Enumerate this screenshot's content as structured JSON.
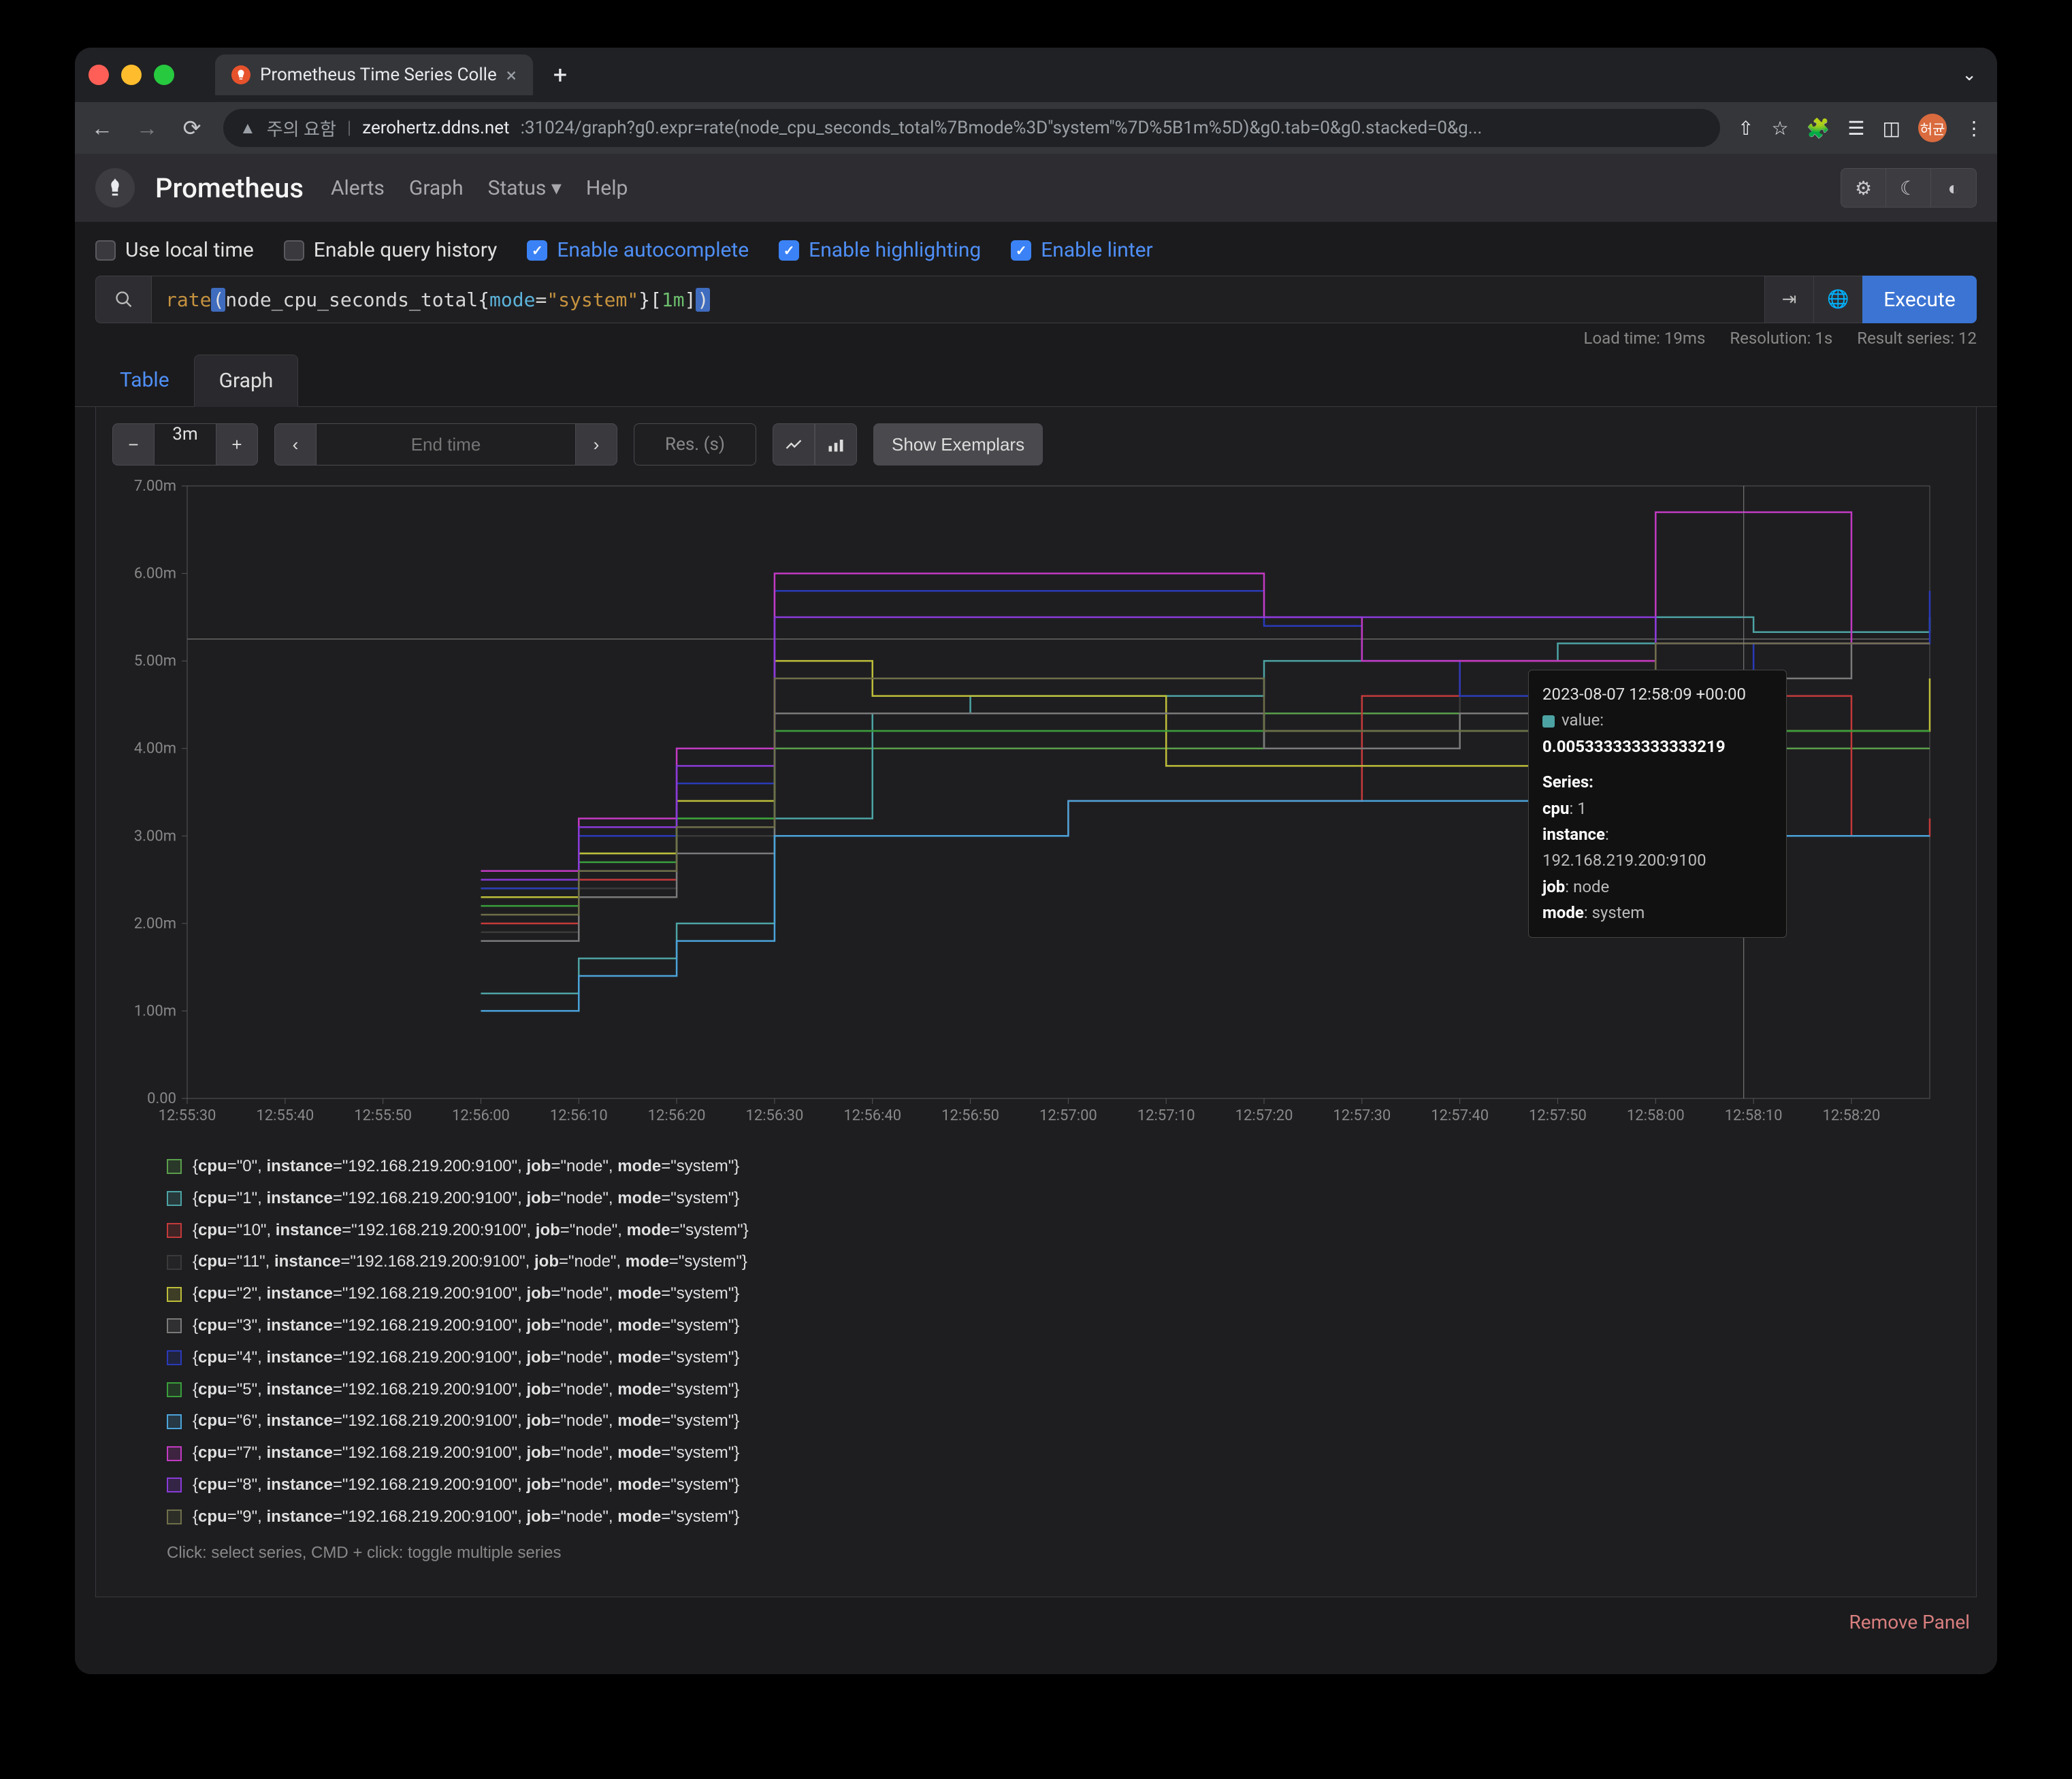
{
  "browser": {
    "tab_title": "Prometheus Time Series Colle",
    "url_warning": "주의 요함",
    "url_host": "zerohertz.ddns.net",
    "url_path": ":31024/graph?g0.expr=rate(node_cpu_seconds_total%7Bmode%3D\"system\"%7D%5B1m%5D)&g0.tab=0&g0.stacked=0&g...",
    "avatar": "허균"
  },
  "app": {
    "title": "Prometheus",
    "nav": [
      "Alerts",
      "Graph",
      "Status",
      "Help"
    ]
  },
  "options": [
    {
      "label": "Use local time",
      "checked": false,
      "blue": false
    },
    {
      "label": "Enable query history",
      "checked": false,
      "blue": false
    },
    {
      "label": "Enable autocomplete",
      "checked": true,
      "blue": true
    },
    {
      "label": "Enable highlighting",
      "checked": true,
      "blue": true
    },
    {
      "label": "Enable linter",
      "checked": true,
      "blue": true
    }
  ],
  "query": {
    "fn": "rate",
    "metric": "node_cpu_seconds_total",
    "label": "mode",
    "value": "\"system\"",
    "range": "1m"
  },
  "execute_label": "Execute",
  "meta": {
    "load_time": "Load time: 19ms",
    "resolution": "Resolution: 1s",
    "result_series": "Result series: 12"
  },
  "tabs": {
    "table": "Table",
    "graph": "Graph",
    "active": "graph"
  },
  "controls": {
    "range": "3m",
    "endtime_placeholder": "End time",
    "res_placeholder": "Res. (s)",
    "show_exemplars": "Show Exemplars"
  },
  "chart_data": {
    "type": "line",
    "xlabel": "",
    "ylabel": "",
    "ylim": [
      0,
      0.007
    ],
    "y_ticks": [
      "0.00",
      "1.00m",
      "2.00m",
      "3.00m",
      "4.00m",
      "5.00m",
      "6.00m",
      "7.00m"
    ],
    "x_ticks": [
      "12:55:30",
      "12:55:40",
      "12:55:50",
      "12:56:00",
      "12:56:10",
      "12:56:20",
      "12:56:30",
      "12:56:40",
      "12:56:50",
      "12:57:00",
      "12:57:10",
      "12:57:20",
      "12:57:30",
      "12:57:40",
      "12:57:50",
      "12:58:00",
      "12:58:10",
      "12:58:20"
    ],
    "x_seconds": [
      0,
      10,
      20,
      30,
      40,
      50,
      60,
      70,
      80,
      90,
      100,
      110,
      120,
      130,
      140,
      150,
      160,
      170,
      178
    ],
    "series": [
      {
        "name": "cpu0",
        "color": "#5a9e4b",
        "values": [
          null,
          null,
          null,
          0.0024,
          0.0028,
          0.0032,
          0.004,
          0.004,
          0.004,
          0.004,
          0.004,
          0.0044,
          0.0044,
          0.0044,
          0.0044,
          0.004,
          0.004,
          0.004,
          0.004
        ]
      },
      {
        "name": "cpu1",
        "color": "#4da3a3",
        "values": [
          null,
          null,
          null,
          0.0012,
          0.0016,
          0.002,
          0.0032,
          0.0044,
          0.0046,
          0.0046,
          0.0046,
          0.005,
          0.005,
          0.005,
          0.0052,
          0.0055,
          0.00533,
          0.00533,
          0.0055
        ]
      },
      {
        "name": "cpu10",
        "color": "#c43a3a",
        "values": [
          null,
          null,
          null,
          0.002,
          0.0025,
          0.003,
          0.003,
          0.003,
          0.003,
          0.0034,
          0.0034,
          0.0034,
          0.0046,
          0.005,
          0.005,
          0.0046,
          0.0046,
          0.003,
          0.0032
        ]
      },
      {
        "name": "cpu11",
        "color": "#3a3a3a",
        "values": [
          null,
          null,
          null,
          0.0019,
          0.0024,
          0.003,
          0.0042,
          0.0042,
          0.0042,
          0.0042,
          0.0042,
          0.0042,
          0.0042,
          0.0046,
          0.0046,
          0.0042,
          0.0042,
          0.0042,
          0.0042
        ]
      },
      {
        "name": "cpu2",
        "color": "#bdbd3a",
        "values": [
          null,
          null,
          null,
          0.0023,
          0.0028,
          0.0034,
          0.005,
          0.0046,
          0.0046,
          0.0046,
          0.0038,
          0.0038,
          0.0038,
          0.0038,
          0.0034,
          0.0038,
          0.0042,
          0.0042,
          0.0048
        ]
      },
      {
        "name": "cpu3",
        "color": "#7a7a7a",
        "values": [
          null,
          null,
          null,
          0.0018,
          0.0023,
          0.0028,
          0.0044,
          0.0044,
          0.0044,
          0.0044,
          0.0044,
          0.004,
          0.004,
          0.0044,
          0.0044,
          0.0048,
          0.0048,
          0.0052,
          0.0052
        ]
      },
      {
        "name": "cpu4",
        "color": "#2a3ab8",
        "values": [
          null,
          null,
          null,
          0.0024,
          0.003,
          0.0036,
          0.0058,
          0.0058,
          0.0058,
          0.0058,
          0.0058,
          0.0054,
          0.005,
          0.0046,
          0.0046,
          0.0046,
          0.0052,
          0.0052,
          0.0058
        ]
      },
      {
        "name": "cpu5",
        "color": "#3a9e3a",
        "values": [
          null,
          null,
          null,
          0.0022,
          0.0027,
          0.0032,
          0.0042,
          0.0042,
          0.0042,
          0.0042,
          0.0042,
          0.0042,
          0.0042,
          0.0042,
          0.0042,
          0.0042,
          0.0042,
          0.0042,
          0.0042
        ]
      },
      {
        "name": "cpu6",
        "color": "#4ba3d9",
        "values": [
          null,
          null,
          null,
          0.001,
          0.0014,
          0.0018,
          0.003,
          0.003,
          0.003,
          0.0034,
          0.0034,
          0.0034,
          0.0034,
          0.0034,
          0.003,
          0.003,
          0.003,
          0.003,
          0.003
        ]
      },
      {
        "name": "cpu7",
        "color": "#c23ac2",
        "values": [
          null,
          null,
          null,
          0.0026,
          0.0032,
          0.004,
          0.006,
          0.006,
          0.006,
          0.006,
          0.006,
          0.0055,
          0.005,
          0.005,
          0.005,
          0.0067,
          0.0067,
          0.0052,
          0.0052
        ]
      },
      {
        "name": "cpu8",
        "color": "#8a3ad9",
        "values": [
          null,
          null,
          null,
          0.0025,
          0.0031,
          0.0038,
          0.0055,
          0.0055,
          0.0055,
          0.0055,
          0.0055,
          0.0055,
          0.0055,
          0.0055,
          0.0055,
          0.0052,
          0.0052,
          0.0052,
          0.0052
        ]
      },
      {
        "name": "cpu9",
        "color": "#6f6f4a",
        "values": [
          null,
          null,
          null,
          0.0021,
          0.0026,
          0.0031,
          0.0048,
          0.0048,
          0.0048,
          0.0048,
          0.0048,
          0.0042,
          0.0042,
          0.0042,
          0.0042,
          0.0052,
          0.0052,
          0.0052,
          0.0052
        ]
      }
    ],
    "baseline": {
      "color": "#555",
      "value": 0.00525
    }
  },
  "tooltip": {
    "time": "2023-08-07 12:58:09 +00:00",
    "series_label": "Series:",
    "value_label": "value:",
    "value": "0.005333333333333219",
    "color": "#4da3a3",
    "fields": [
      {
        "k": "cpu",
        "v": "1"
      },
      {
        "k": "instance",
        "v": "192.168.219.200:9100"
      },
      {
        "k": "job",
        "v": "node"
      },
      {
        "k": "mode",
        "v": "system"
      }
    ]
  },
  "legend": {
    "items": [
      {
        "cpu": "0",
        "color": "#5a9e4b"
      },
      {
        "cpu": "1",
        "color": "#4da3a3"
      },
      {
        "cpu": "10",
        "color": "#c43a3a"
      },
      {
        "cpu": "11",
        "color": "#3a3a3a"
      },
      {
        "cpu": "2",
        "color": "#bdbd3a"
      },
      {
        "cpu": "3",
        "color": "#7a7a7a"
      },
      {
        "cpu": "4",
        "color": "#2a3ab8"
      },
      {
        "cpu": "5",
        "color": "#3a9e3a"
      },
      {
        "cpu": "6",
        "color": "#4ba3d9"
      },
      {
        "cpu": "7",
        "color": "#c23ac2"
      },
      {
        "cpu": "8",
        "color": "#8a3ad9"
      },
      {
        "cpu": "9",
        "color": "#6f6f4a"
      }
    ],
    "instance": "192.168.219.200:9100",
    "job": "node",
    "mode": "system",
    "hint": "Click: select series, CMD + click: toggle multiple series"
  },
  "remove_panel": "Remove Panel"
}
